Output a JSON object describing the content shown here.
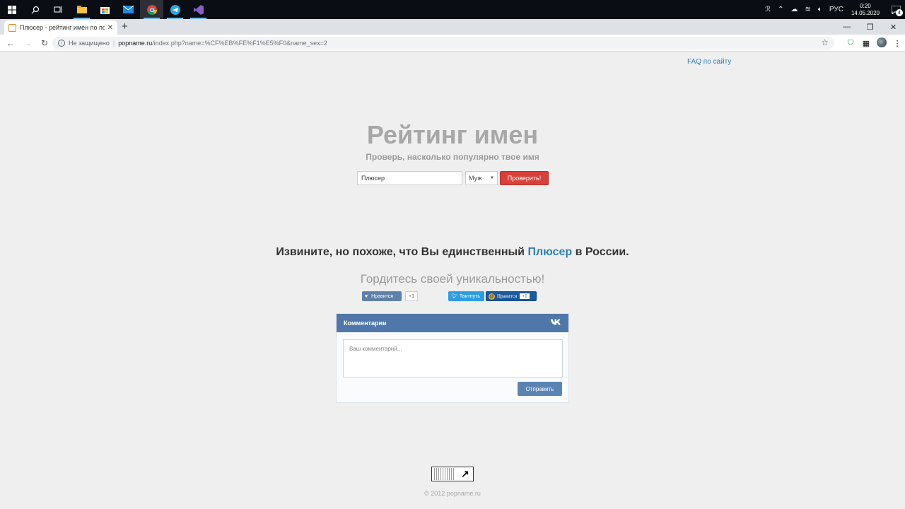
{
  "taskbar": {
    "clock_time": "0:20",
    "clock_date": "14.05.2020",
    "lang": "РУС",
    "notification_count": "4"
  },
  "browser": {
    "tab_title": "Плюсер - рейтинг имен по попу",
    "tab_close": "✕",
    "new_tab": "+",
    "security_label": "Не защищено",
    "url_host": "popname.ru",
    "url_path": "/index.php?name=%CF%EB%FE%F1%E5%F0&name_sex=2"
  },
  "page": {
    "faq_link": "FAQ по сайту",
    "title": "Рейтинг имен",
    "subtitle": "Проверь, насколько популярно твое имя",
    "name_value": "Плюсер",
    "sex_selected": "Муж",
    "check_button": "Проверить!",
    "message_before": "Извините, но похоже, что Вы единственный ",
    "message_name": "Плюсер",
    "message_after": " в России.",
    "proud_text": "Гордитесь своей уникальностью!",
    "vk_like_label": "Нравится",
    "vk_like_count": "+1",
    "tweet_label": "Твитнуть",
    "mailru_like_label": "Нравится",
    "mailru_count": "+1",
    "comments_title": "Комментарии",
    "comments_placeholder": "Ваш комментарий...",
    "send_button": "Отправить",
    "copyright": "© 2012 popname.ru"
  },
  "colors": {
    "accent_link": "#2f7fb5",
    "check_button": "#d9403a",
    "vk_header": "#4f77a9"
  }
}
